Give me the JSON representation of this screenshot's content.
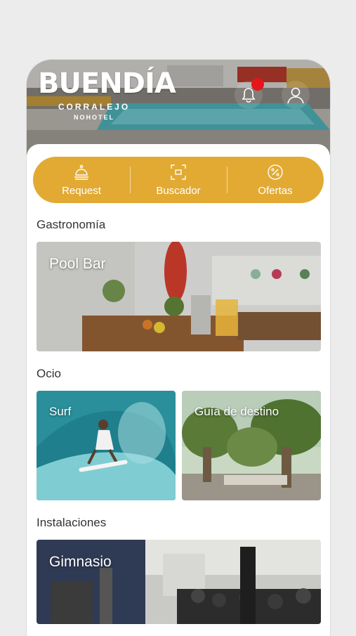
{
  "header": {
    "logo_main": "BUENDÍA",
    "logo_sub1": "CORRALEJO",
    "logo_sub2": "NOHOTEL",
    "notification_icon": "bell-icon",
    "profile_icon": "user-icon"
  },
  "quick_actions": [
    {
      "label": "Request",
      "icon": "bell-service-icon"
    },
    {
      "label": "Buscador",
      "icon": "scan-icon"
    },
    {
      "label": "Ofertas",
      "icon": "percent-icon"
    }
  ],
  "sections": {
    "gastronomia": {
      "title": "Gastronomía",
      "cards": [
        {
          "label": "Pool Bar"
        }
      ]
    },
    "ocio": {
      "title": "Ocio",
      "cards": [
        {
          "label": "Surf"
        },
        {
          "label": "Guía de destino"
        }
      ]
    },
    "instalaciones": {
      "title": "Instalaciones",
      "cards": [
        {
          "label": "Gimnasio"
        }
      ]
    }
  },
  "colors": {
    "accent": "#e2aa33",
    "notification": "#e8141b",
    "background": "#ececec"
  }
}
